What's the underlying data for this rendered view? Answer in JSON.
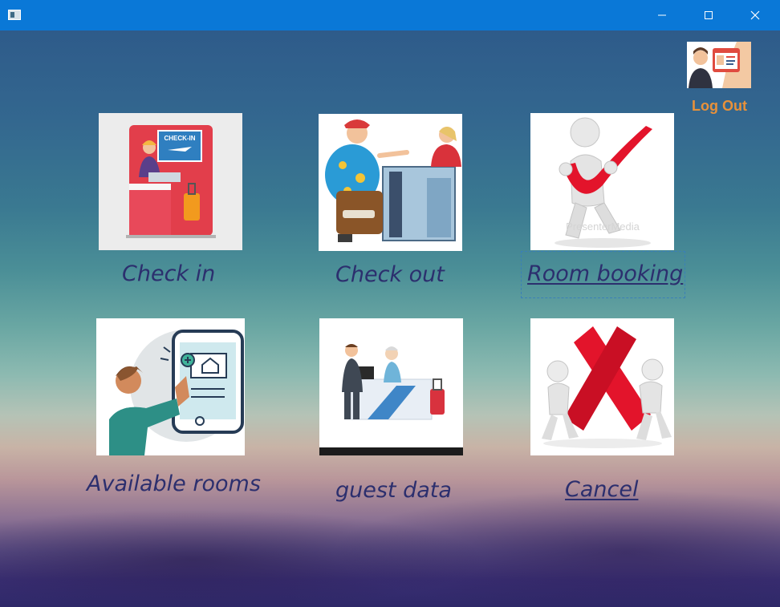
{
  "window": {
    "controls": {
      "minimize_icon": "minimize-icon",
      "maximize_icon": "maximize-icon",
      "close_icon": "close-icon"
    }
  },
  "header": {
    "logout_label": "Log Out",
    "logout_icon": "id-badge-icon"
  },
  "menu": {
    "check_in": {
      "label": "Check in",
      "icon": "check-in-counter-image"
    },
    "check_out": {
      "label": "Check out",
      "icon": "check-out-counter-image"
    },
    "room_booking": {
      "label": "Room booking",
      "icon": "checkmark-figure-image"
    },
    "available_rooms": {
      "label": "Available rooms",
      "icon": "phone-booking-image"
    },
    "guest_data": {
      "label": "guest data",
      "icon": "reception-desk-image"
    },
    "cancel": {
      "label": "Cancel",
      "icon": "cross-figure-image"
    }
  },
  "colors": {
    "titlebar": "#0a78d7",
    "label_text": "#2c2f6e",
    "logout_text": "#e8913a"
  }
}
